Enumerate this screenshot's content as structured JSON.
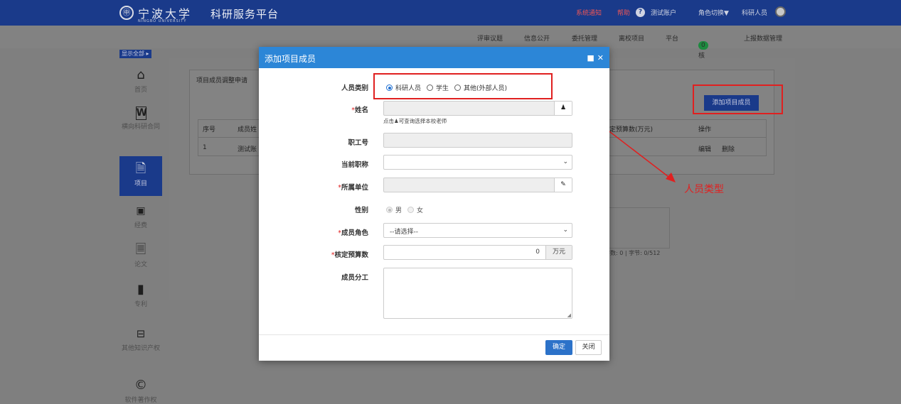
{
  "header": {
    "seal_char": "㊥",
    "university": "宁波大学",
    "university_en": "NINGBO UNIVERSITY",
    "platform": "科研服务平台",
    "notice_1": "系统通知",
    "notice_2": "帮助",
    "account": "测试账户",
    "role_switch": "角色切换▼",
    "user": "科研人员"
  },
  "subnav": {
    "items": [
      "评审议题",
      "信息公开",
      "委托管理",
      "离校项目",
      "平台",
      "考核",
      "上报数据管理"
    ],
    "badge": "0"
  },
  "sidebar": {
    "show_all": "显示全部 ▸",
    "items": [
      {
        "label": "首页",
        "icon": "home-icon"
      },
      {
        "label": "横向科研合同",
        "icon": "word-doc-icon"
      },
      {
        "label": "项目",
        "icon": "document-icon"
      },
      {
        "label": "经费",
        "icon": "money-icon"
      },
      {
        "label": "论文",
        "icon": "paper-icon"
      },
      {
        "label": "专利",
        "icon": "bookmark-icon"
      },
      {
        "label": "其他知识产权",
        "icon": "drive-icon"
      },
      {
        "label": "软件著作权",
        "icon": "copyright-icon"
      }
    ]
  },
  "background": {
    "panel_title": "项目成员调整申请",
    "add_member_btn": "添加项目成员",
    "table_headers": [
      "序号",
      "成员姓",
      "定预算数(万元)",
      "操作"
    ],
    "row": {
      "no": "1",
      "name": "测试账",
      "edit": "编辑",
      "delete": "删除"
    },
    "char_count": "字数: 0 | 字节: 0/512",
    "annotation": "人员类型"
  },
  "modal": {
    "title": "添加项目成员",
    "labels": {
      "type": "人员类别",
      "name": "姓名",
      "staff_no": "职工号",
      "title": "当前职称",
      "unit": "所属单位",
      "gender": "性别",
      "role": "成员角色",
      "budget": "核定预算数",
      "division": "成员分工"
    },
    "type_options": [
      "科研人员",
      "学生",
      "其他(外部人员)"
    ],
    "type_selected": "科研人员",
    "name_hint": "点击♟可查询选择本校老师",
    "gender_options": [
      "男",
      "女"
    ],
    "role_placeholder": "--请选择--",
    "budget_value": "0",
    "budget_unit": "万元",
    "ok": "确定",
    "close": "关闭"
  },
  "colors": {
    "header": "#1a3a8a",
    "modal_header": "#2c86d7",
    "annotation": "#e02020"
  }
}
